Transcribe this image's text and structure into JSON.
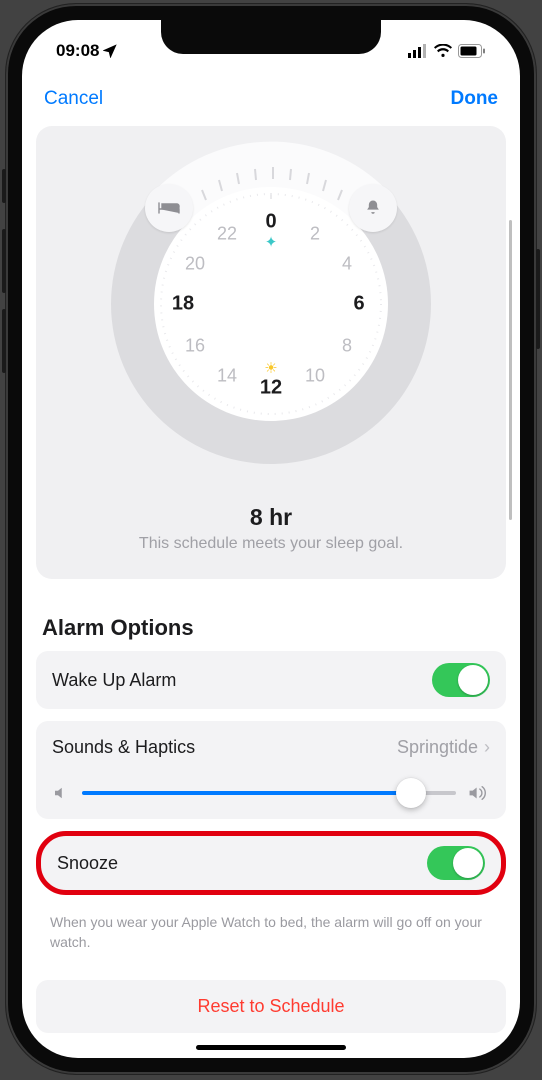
{
  "status": {
    "time": "09:08"
  },
  "nav": {
    "cancel": "Cancel",
    "done": "Done"
  },
  "dial": {
    "hours": [
      "0",
      "2",
      "4",
      "6",
      "8",
      "10",
      "12",
      "14",
      "16",
      "18",
      "20",
      "22"
    ],
    "bold_hours": [
      "0",
      "6",
      "12",
      "18"
    ],
    "duration": "8 hr",
    "subtitle": "This schedule meets your sleep goal."
  },
  "section": {
    "title": "Alarm Options"
  },
  "rows": {
    "wake_label": "Wake Up Alarm",
    "sounds_label": "Sounds & Haptics",
    "sounds_value": "Springtide",
    "snooze_label": "Snooze"
  },
  "footer": "When you wear your Apple Watch to bed, the alarm will go off on your watch.",
  "reset": "Reset to Schedule",
  "colors": {
    "accent": "#007aff",
    "green": "#34c759",
    "red": "#ff3b30",
    "highlight": "#e1000f"
  }
}
